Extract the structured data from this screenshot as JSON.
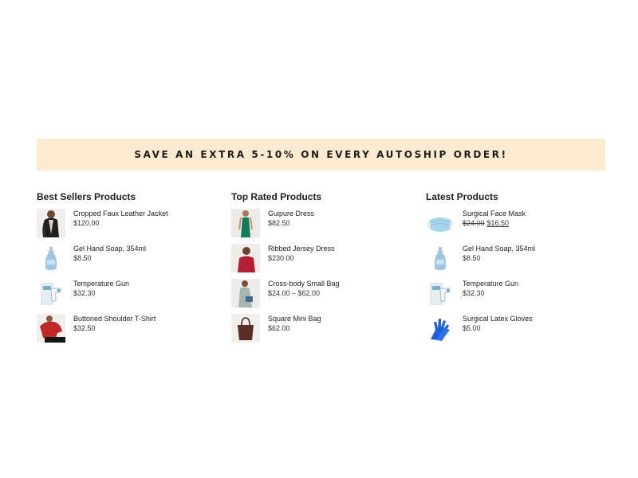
{
  "banner": {
    "text": "SAVE AN EXTRA 5-10% ON EVERY AUTOSHIP ORDER!",
    "background_color": "#fcebd0"
  },
  "columns": [
    {
      "title": "Best Sellers Products",
      "products": [
        {
          "name": "Cropped Faux Leather Jacket",
          "price": "$120.00",
          "icon": "jacket-photo"
        },
        {
          "name": "Gel Hand Soap, 354ml",
          "price": "$8.50",
          "icon": "soap-bottle-photo"
        },
        {
          "name": "Temperature Gun",
          "price": "$32.30",
          "icon": "temperature-gun-photo"
        },
        {
          "name": "Buttoned Shoulder T-Shirt",
          "price": "$32.50",
          "icon": "red-shirt-photo"
        }
      ]
    },
    {
      "title": "Top Rated Products",
      "products": [
        {
          "name": "Guipure Dress",
          "price": "$82.50",
          "icon": "green-dress-photo"
        },
        {
          "name": "Ribbed Jersey Dress",
          "price": "$230.00",
          "icon": "red-dress-photo"
        },
        {
          "name": "Cross-body Small Bag",
          "price": "$24.00 – $62.00",
          "icon": "crossbody-bag-photo"
        },
        {
          "name": "Square Mini Bag",
          "price": "$62.00",
          "icon": "brown-bag-photo"
        }
      ]
    },
    {
      "title": "Latest Products",
      "products": [
        {
          "name": "Surgical Face Mask",
          "price_old": "$24.00",
          "price_new": "$16.50",
          "icon": "face-mask-photo"
        },
        {
          "name": "Gel Hand Soap, 354ml",
          "price": "$8.50",
          "icon": "soap-bottle-photo"
        },
        {
          "name": "Temperature Gun",
          "price": "$32.30",
          "icon": "temperature-gun-photo"
        },
        {
          "name": "Surgical Latex Gloves",
          "price": "$5.00",
          "icon": "latex-gloves-photo"
        }
      ]
    }
  ]
}
